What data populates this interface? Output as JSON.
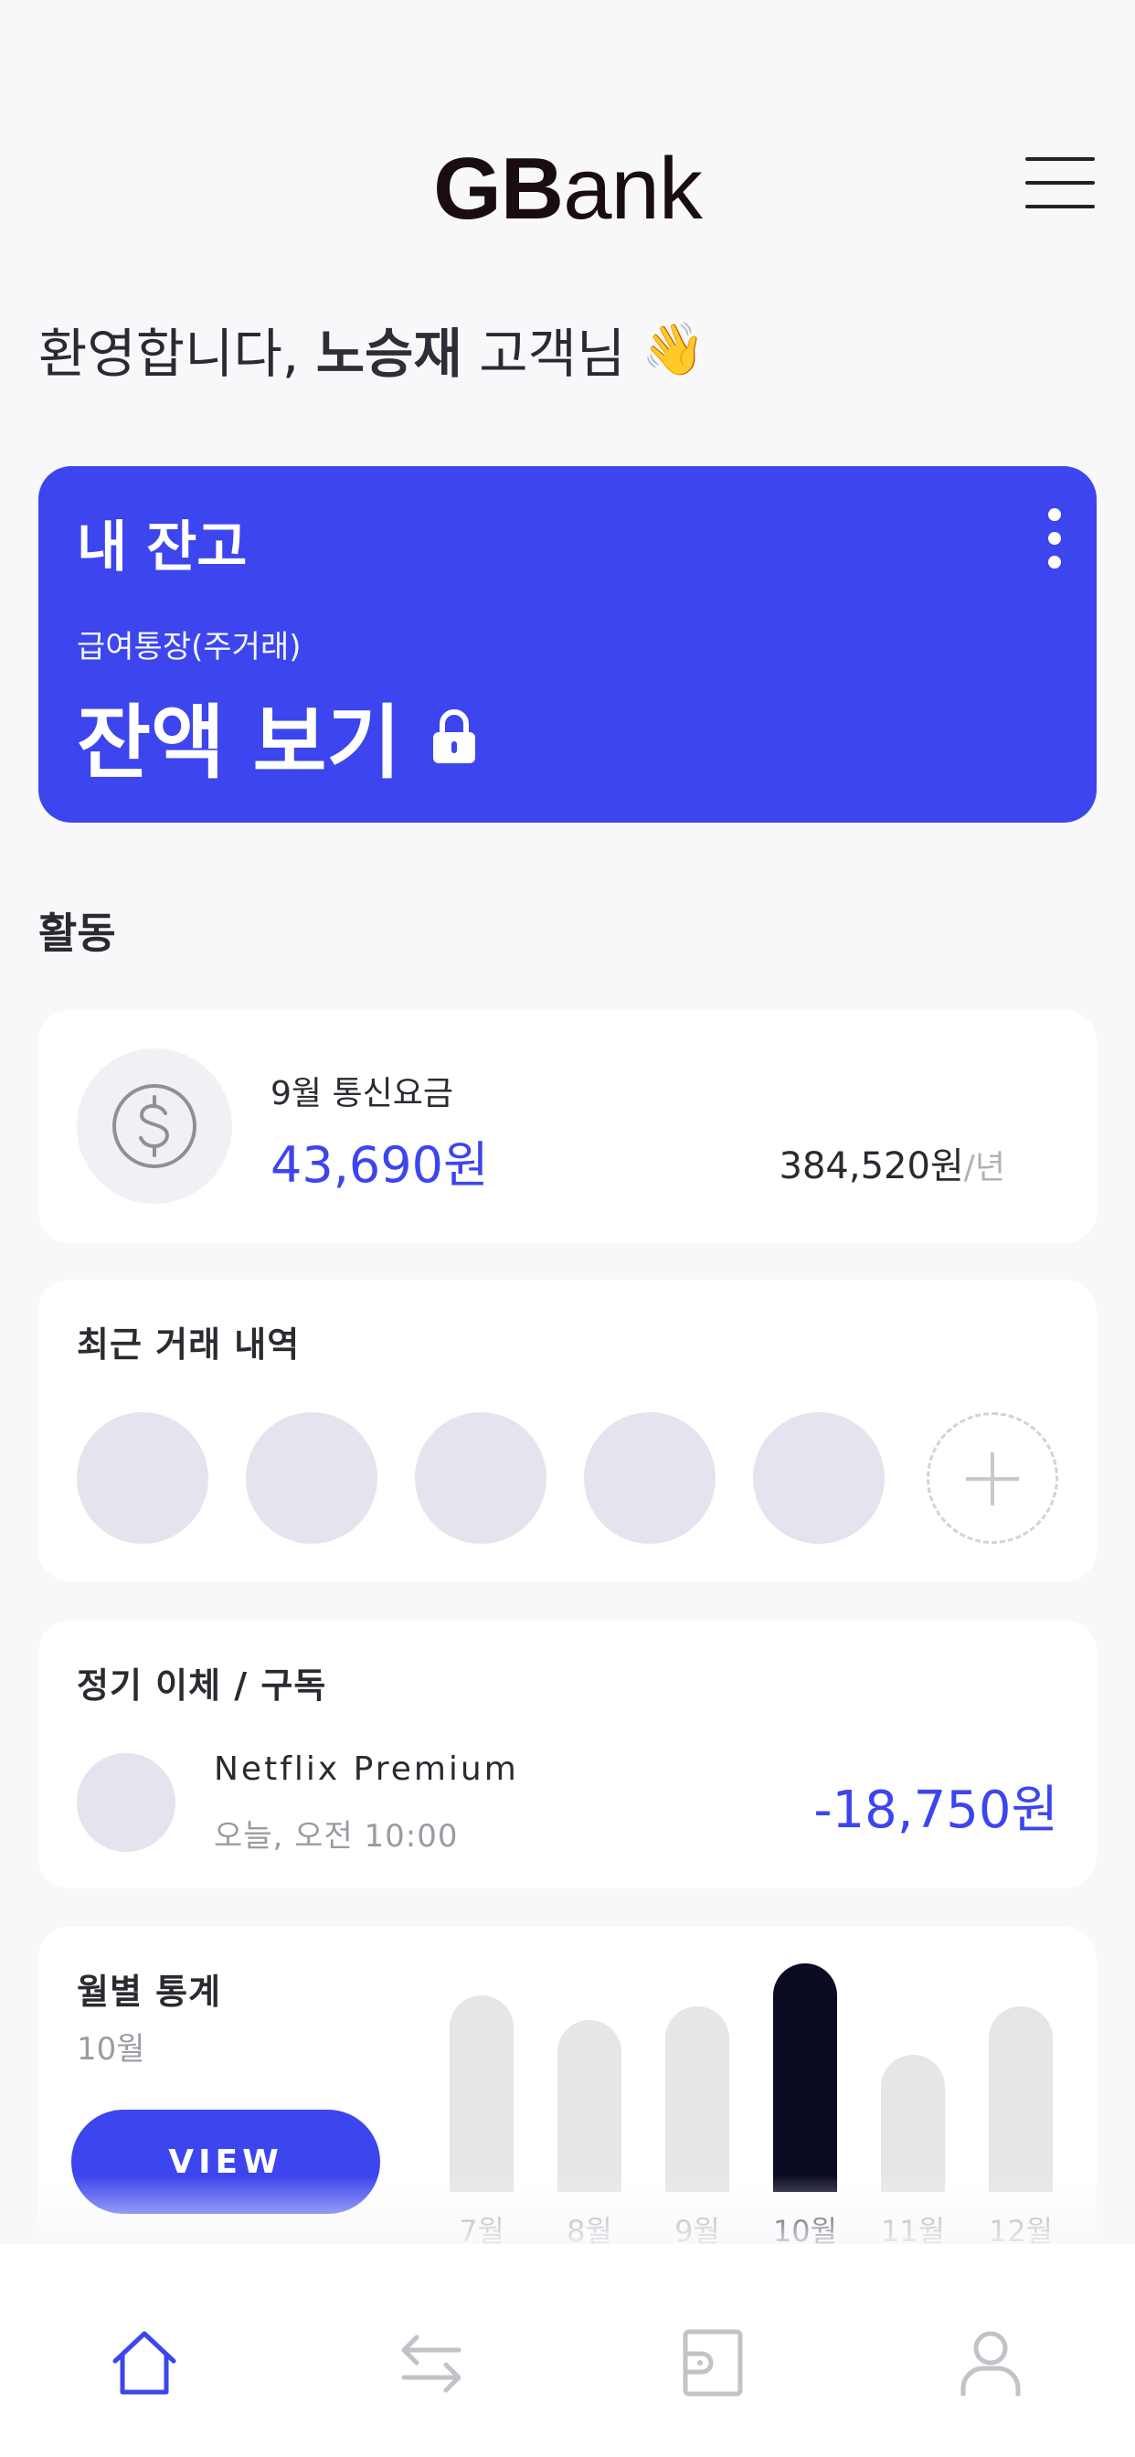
{
  "header": {
    "logo_bold": "GB",
    "logo_light": "ank"
  },
  "greeting": {
    "prefix": "환영합니다, ",
    "name": "노승재",
    "suffix": " 고객님",
    "emoji": "👋"
  },
  "balance_card": {
    "title": "내 잔고",
    "account_name": "급여통장(주거래)",
    "show_balance_label": "잔액 보기",
    "color": "#3c45ee"
  },
  "activity": {
    "section_label": "활동",
    "bill": {
      "title": "9월 통신요금",
      "amount": "43,690원",
      "yearly_amount": "384,520원",
      "yearly_unit": "/년",
      "icon": "dollar-coin-icon"
    }
  },
  "recent": {
    "title": "최근 거래 내역",
    "add_icon": "plus-icon"
  },
  "subscriptions": {
    "title": "정기 이체 / 구독",
    "items": [
      {
        "name": "Netflix Premium",
        "time": "오늘, 오전 10:00",
        "amount": "-18,750원"
      }
    ]
  },
  "stats": {
    "title": "월별 통계",
    "current_month": "10월",
    "view_label": "VIEW",
    "chart_data": {
      "type": "bar",
      "categories": [
        "7월",
        "8월",
        "9월",
        "10월",
        "11월",
        "12월"
      ],
      "values": [
        86,
        75,
        81,
        100,
        60,
        81
      ],
      "highlight": "10월",
      "ylim": [
        0,
        100
      ],
      "active_color": "#0b0b24",
      "inactive_color": "#e6e6e9"
    }
  },
  "tabbar": {
    "tabs": [
      {
        "icon": "home-icon",
        "active": true
      },
      {
        "icon": "transfer-arrows-icon",
        "active": false
      },
      {
        "icon": "wallet-icon",
        "active": false
      },
      {
        "icon": "profile-icon",
        "active": false
      }
    ],
    "active_color": "#3c45ee",
    "inactive_color": "#c2c2c8"
  }
}
